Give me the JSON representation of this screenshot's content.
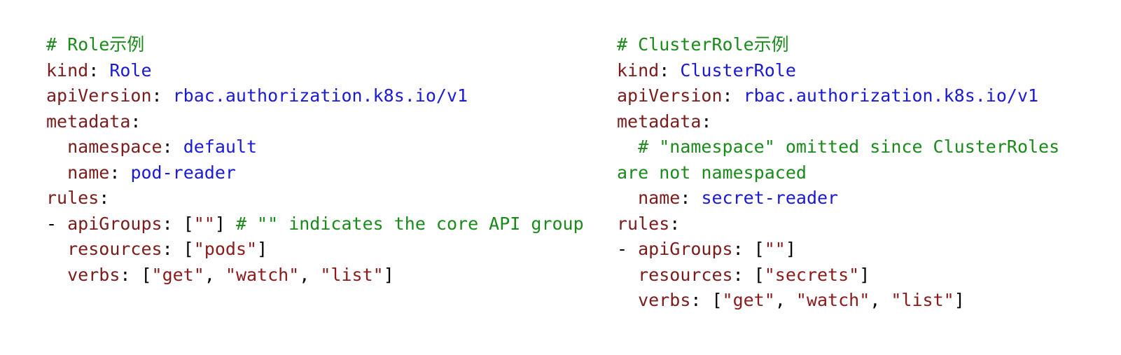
{
  "colors": {
    "key": "#7a1c1c",
    "value": "#1a1ad6",
    "string": "#8b1a1a",
    "comment": "#1a8a1a",
    "punctuation": "#000000"
  },
  "blocks": [
    {
      "lines": [
        [
          {
            "t": "com",
            "s": "# Role示例"
          }
        ],
        [
          {
            "t": "key",
            "s": "kind"
          },
          {
            "t": "pun",
            "s": ": "
          },
          {
            "t": "val",
            "s": "Role"
          }
        ],
        [
          {
            "t": "key",
            "s": "apiVersion"
          },
          {
            "t": "pun",
            "s": ": "
          },
          {
            "t": "val",
            "s": "rbac.authorization.k8s.io/v1"
          }
        ],
        [
          {
            "t": "key",
            "s": "metadata"
          },
          {
            "t": "pun",
            "s": ":"
          }
        ],
        [
          {
            "t": "pun",
            "s": "  "
          },
          {
            "t": "key",
            "s": "namespace"
          },
          {
            "t": "pun",
            "s": ": "
          },
          {
            "t": "val",
            "s": "default"
          }
        ],
        [
          {
            "t": "pun",
            "s": "  "
          },
          {
            "t": "key",
            "s": "name"
          },
          {
            "t": "pun",
            "s": ": "
          },
          {
            "t": "val",
            "s": "pod-reader"
          }
        ],
        [
          {
            "t": "key",
            "s": "rules"
          },
          {
            "t": "pun",
            "s": ":"
          }
        ],
        [
          {
            "t": "pun",
            "s": "- "
          },
          {
            "t": "key",
            "s": "apiGroups"
          },
          {
            "t": "pun",
            "s": ": ["
          },
          {
            "t": "str",
            "s": "\"\""
          },
          {
            "t": "pun",
            "s": "] "
          },
          {
            "t": "com",
            "s": "# \"\" indicates the core API group"
          }
        ],
        [
          {
            "t": "pun",
            "s": "  "
          },
          {
            "t": "key",
            "s": "resources"
          },
          {
            "t": "pun",
            "s": ": ["
          },
          {
            "t": "str",
            "s": "\"pods\""
          },
          {
            "t": "pun",
            "s": "]"
          }
        ],
        [
          {
            "t": "pun",
            "s": "  "
          },
          {
            "t": "key",
            "s": "verbs"
          },
          {
            "t": "pun",
            "s": ": ["
          },
          {
            "t": "str",
            "s": "\"get\""
          },
          {
            "t": "pun",
            "s": ", "
          },
          {
            "t": "str",
            "s": "\"watch\""
          },
          {
            "t": "pun",
            "s": ", "
          },
          {
            "t": "str",
            "s": "\"list\""
          },
          {
            "t": "pun",
            "s": "]"
          }
        ]
      ]
    },
    {
      "lines": [
        [
          {
            "t": "com",
            "s": "# ClusterRole示例"
          }
        ],
        [
          {
            "t": "key",
            "s": "kind"
          },
          {
            "t": "pun",
            "s": ": "
          },
          {
            "t": "val",
            "s": "ClusterRole"
          }
        ],
        [
          {
            "t": "key",
            "s": "apiVersion"
          },
          {
            "t": "pun",
            "s": ": "
          },
          {
            "t": "val",
            "s": "rbac.authorization.k8s.io/v1"
          }
        ],
        [
          {
            "t": "key",
            "s": "metadata"
          },
          {
            "t": "pun",
            "s": ":"
          }
        ],
        [
          {
            "t": "pun",
            "s": "  "
          },
          {
            "t": "com",
            "s": "# \"namespace\" omitted since ClusterRoles"
          }
        ],
        [
          {
            "t": "com",
            "s": "are not namespaced"
          }
        ],
        [
          {
            "t": "pun",
            "s": "  "
          },
          {
            "t": "key",
            "s": "name"
          },
          {
            "t": "pun",
            "s": ": "
          },
          {
            "t": "val",
            "s": "secret-reader"
          }
        ],
        [
          {
            "t": "key",
            "s": "rules"
          },
          {
            "t": "pun",
            "s": ":"
          }
        ],
        [
          {
            "t": "pun",
            "s": "- "
          },
          {
            "t": "key",
            "s": "apiGroups"
          },
          {
            "t": "pun",
            "s": ": ["
          },
          {
            "t": "str",
            "s": "\"\""
          },
          {
            "t": "pun",
            "s": "]"
          }
        ],
        [
          {
            "t": "pun",
            "s": "  "
          },
          {
            "t": "key",
            "s": "resources"
          },
          {
            "t": "pun",
            "s": ": ["
          },
          {
            "t": "str",
            "s": "\"secrets\""
          },
          {
            "t": "pun",
            "s": "]"
          }
        ],
        [
          {
            "t": "pun",
            "s": "  "
          },
          {
            "t": "key",
            "s": "verbs"
          },
          {
            "t": "pun",
            "s": ": ["
          },
          {
            "t": "str",
            "s": "\"get\""
          },
          {
            "t": "pun",
            "s": ", "
          },
          {
            "t": "str",
            "s": "\"watch\""
          },
          {
            "t": "pun",
            "s": ", "
          },
          {
            "t": "str",
            "s": "\"list\""
          },
          {
            "t": "pun",
            "s": "]"
          }
        ]
      ]
    }
  ]
}
